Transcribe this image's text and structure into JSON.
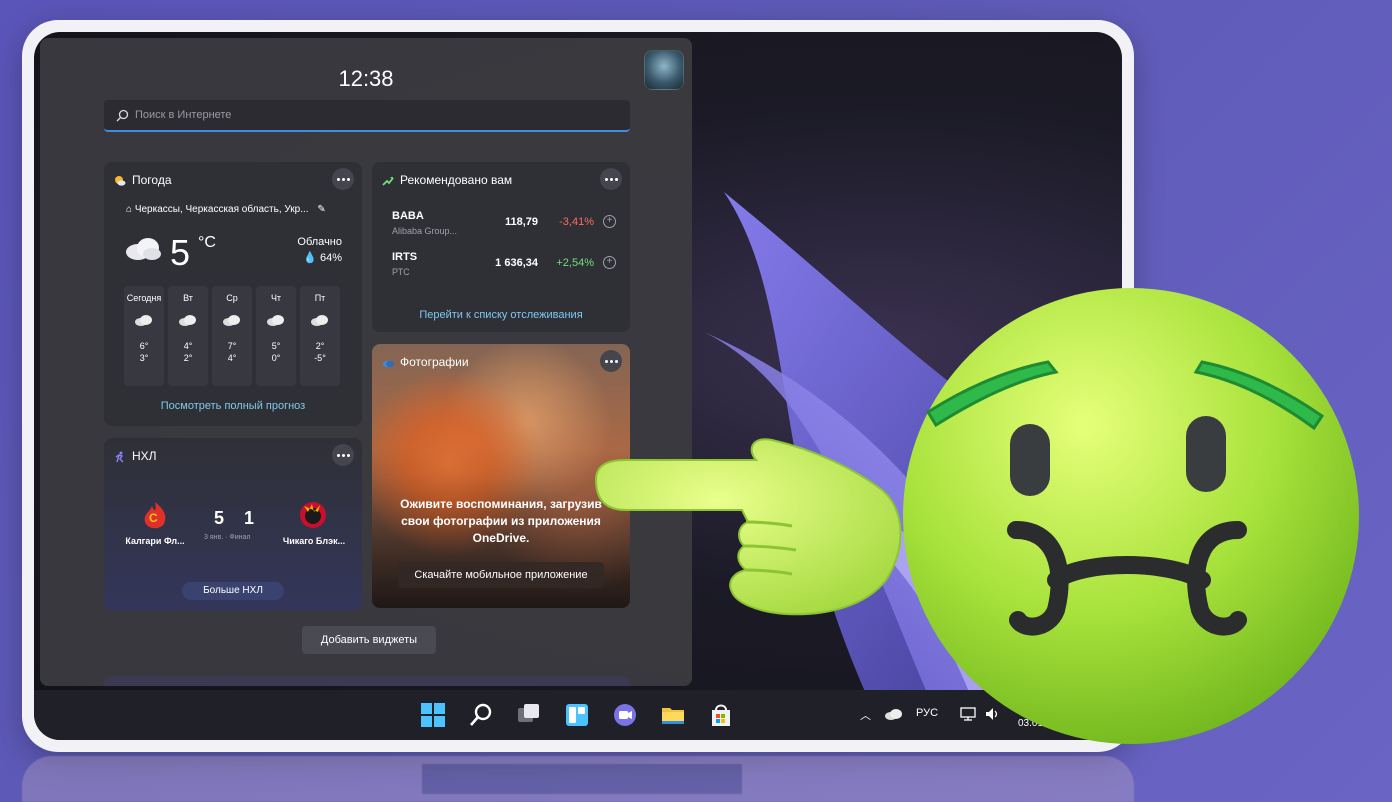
{
  "panel": {
    "time": "12:38",
    "search": {
      "placeholder": "Поиск в Интернете"
    },
    "add_widgets_label": "Добавить виджеты"
  },
  "weather": {
    "title": "Погода",
    "location": "Черкассы, Черкасская область, Укр...",
    "temperature": "5",
    "unit": "°C",
    "condition": "Облачно",
    "humidity": "64%",
    "days": [
      {
        "name": "Сегодня",
        "high": "6°",
        "low": "3°"
      },
      {
        "name": "Вт",
        "high": "4°",
        "low": "2°"
      },
      {
        "name": "Ср",
        "high": "7°",
        "low": "4°"
      },
      {
        "name": "Чт",
        "high": "5°",
        "low": "0°"
      },
      {
        "name": "Пт",
        "high": "2°",
        "low": "-5°"
      }
    ],
    "forecast_link": "Посмотреть полный прогноз"
  },
  "stocks": {
    "title": "Рекомендовано вам",
    "items": [
      {
        "symbol": "BABA",
        "name": "Alibaba Group...",
        "price": "118,79",
        "change": "-3,41%",
        "change_color": "#ff6b5a"
      },
      {
        "symbol": "IRTS",
        "name": "РТС",
        "price": "1 636,34",
        "change": "+2,54%",
        "change_color": "#6fe07a"
      }
    ],
    "watchlist_link": "Перейти к списку отслеживания"
  },
  "photos": {
    "title": "Фотографии",
    "message": "Оживите воспоминания, загрузив свои фотографии из приложения OneDrive.",
    "button": "Скачайте мобильное приложение"
  },
  "nhl": {
    "title": "НХЛ",
    "home_team": "Калгари Фл...",
    "away_team": "Чикаго Блэк...",
    "home_score": "5",
    "away_score": "1",
    "meta": "3 янв. · Финал",
    "more_link": "Больше НХЛ"
  },
  "taskbar": {
    "language": "РУС",
    "date": "03.01.20"
  },
  "colors": {
    "accent": "#3c8ee0",
    "link": "#7fc8f0",
    "emoji_green": "#9adf3a"
  }
}
